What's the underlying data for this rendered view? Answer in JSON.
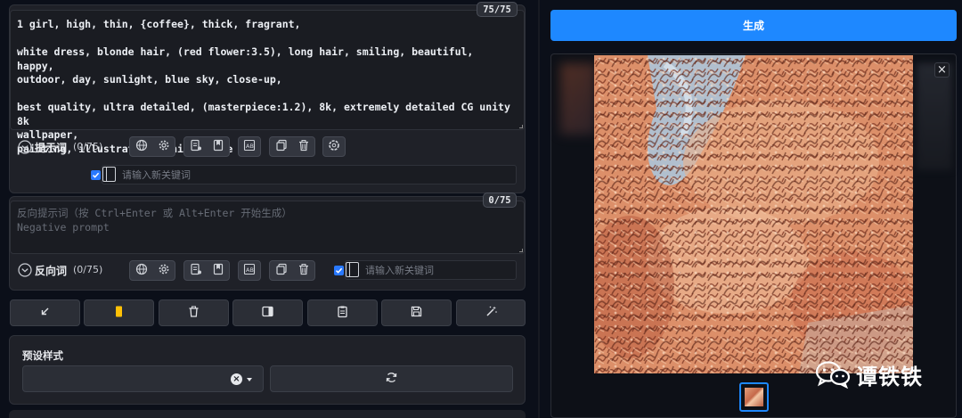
{
  "prompt": {
    "counter": "75/75",
    "lines": [
      "1 girl, high, thin, {coffee}, thick, fragrant,",
      "",
      "white dress, blonde hair, (red flower:3.5), long hair, smiling, beautiful, happy,",
      "outdoor, day, sunlight, blue sky, close-up,",
      "",
      "best quality, ultra detailed, (masterpiece:1.2), 8k, extremely detailed CG unity 8k",
      "wallpaper,",
      "painting, illustration, anime, game cg,"
    ],
    "label": "提示词",
    "count": "(0/75)",
    "keyword_placeholder": "请输入新关键词"
  },
  "negative": {
    "counter": "0/75",
    "placeholder_lines": [
      "反向提示词（按 Ctrl+Enter 或 Alt+Enter 开始生成）",
      "Negative prompt"
    ],
    "label": "反向词",
    "count": "(0/75)",
    "keyword_placeholder": "请输入新关键词"
  },
  "toolbar_icons": [
    "globe-icon",
    "gear-icon",
    "list-edit-icon",
    "bookmark-icon",
    "translate-icon",
    "copy-icon",
    "trash-icon",
    "openai-icon"
  ],
  "action_icons": [
    "arrow-down-left-icon",
    "yellow-bar-icon",
    "trash-icon",
    "panel-icon",
    "clipboard-icon",
    "save-icon",
    "magic-wand-icon"
  ],
  "preset": {
    "label": "预设样式"
  },
  "generate": {
    "label": "生成"
  },
  "gallery": {
    "close_glyph": "×"
  },
  "watermark": {
    "text": "谭铁铁"
  },
  "colors": {
    "accent": "#1e88ff",
    "background": "#0b0f19",
    "panel": "#1f2128"
  }
}
